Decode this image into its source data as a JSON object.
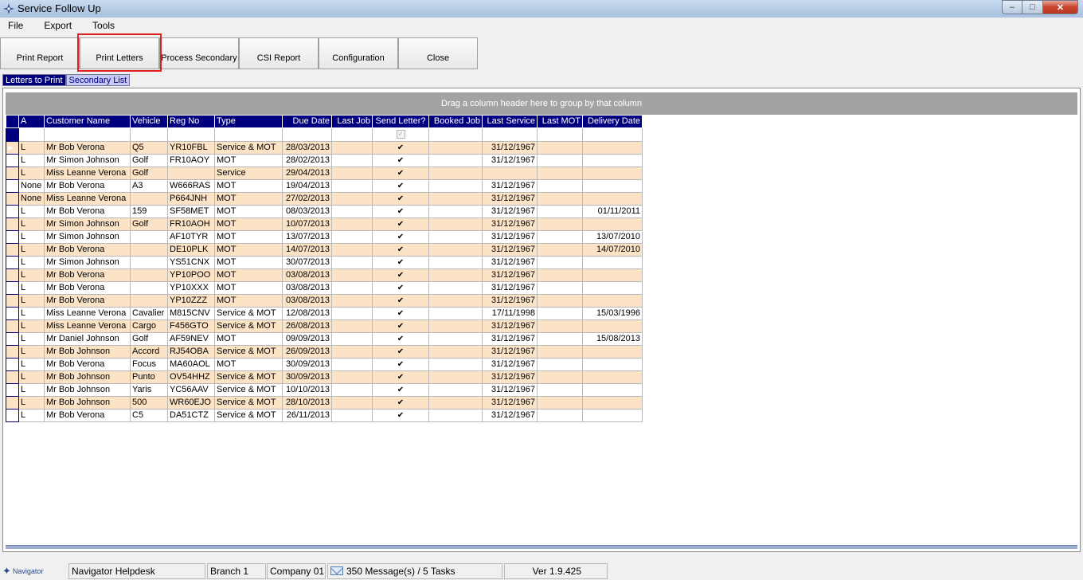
{
  "window": {
    "title": "Service Follow Up",
    "minimize_glyph": "–",
    "maximize_glyph": "□",
    "close_glyph": "✕",
    "icon": "navigator-compass-icon"
  },
  "menu": [
    "File",
    "Export",
    "Tools"
  ],
  "toolbar": {
    "buttons": [
      {
        "label": "Print Report"
      },
      {
        "label": "Print Letters"
      },
      {
        "label": "Process Secondary"
      },
      {
        "label": "CSI Report"
      },
      {
        "label": "Configuration"
      },
      {
        "label": "Close"
      }
    ]
  },
  "tabs": [
    {
      "label": "Letters to Print",
      "active": true
    },
    {
      "label": "Secondary List",
      "active": false
    }
  ],
  "grid": {
    "group_hint": "Drag a column header here to group by that column",
    "columns": [
      "A",
      "Customer Name",
      "Vehicle",
      "Reg No",
      "Type",
      "Due Date",
      "Last Job",
      "Send Letter?",
      "Booked Job",
      "Last Service",
      "Last MOT",
      "Delivery Date"
    ],
    "rows": [
      {
        "a": "L",
        "customer": "Mr Bob Verona",
        "vehicle": "Q5",
        "reg": "YR10FBL",
        "type": "Service  & MOT",
        "due": "28/03/2013",
        "last_job": "",
        "send": true,
        "booked": "",
        "last_service": "31/12/1967",
        "last_mot": "",
        "delivery": ""
      },
      {
        "a": "L",
        "customer": "Mr Simon Johnson",
        "vehicle": "Golf",
        "reg": "FR10AOY",
        "type": "MOT",
        "due": "28/02/2013",
        "last_job": "",
        "send": true,
        "booked": "",
        "last_service": "31/12/1967",
        "last_mot": "",
        "delivery": ""
      },
      {
        "a": "L",
        "customer": "Miss Leanne Verona",
        "vehicle": "Golf",
        "reg": "",
        "type": "Service",
        "due": "29/04/2013",
        "last_job": "",
        "send": true,
        "booked": "",
        "last_service": "",
        "last_mot": "",
        "delivery": ""
      },
      {
        "a": "None",
        "customer": "Mr Bob Verona",
        "vehicle": "A3",
        "reg": "W666RAS",
        "type": "MOT",
        "due": "19/04/2013",
        "last_job": "",
        "send": true,
        "booked": "",
        "last_service": "31/12/1967",
        "last_mot": "",
        "delivery": ""
      },
      {
        "a": "None",
        "customer": "Miss Leanne Verona",
        "vehicle": "",
        "reg": "P664JNH",
        "type": "MOT",
        "due": "27/02/2013",
        "last_job": "",
        "send": true,
        "booked": "",
        "last_service": "31/12/1967",
        "last_mot": "",
        "delivery": ""
      },
      {
        "a": "L",
        "customer": "Mr Bob Verona",
        "vehicle": "159",
        "reg": "SF58MET",
        "type": "MOT",
        "due": "08/03/2013",
        "last_job": "",
        "send": true,
        "booked": "",
        "last_service": "31/12/1967",
        "last_mot": "",
        "delivery": "01/11/2011"
      },
      {
        "a": "L",
        "customer": "Mr Simon Johnson",
        "vehicle": "Golf",
        "reg": "FR10AOH",
        "type": "MOT",
        "due": "10/07/2013",
        "last_job": "",
        "send": true,
        "booked": "",
        "last_service": "31/12/1967",
        "last_mot": "",
        "delivery": ""
      },
      {
        "a": "L",
        "customer": "Mr Simon Johnson",
        "vehicle": "",
        "reg": "AF10TYR",
        "type": "MOT",
        "due": "13/07/2013",
        "last_job": "",
        "send": true,
        "booked": "",
        "last_service": "31/12/1967",
        "last_mot": "",
        "delivery": "13/07/2010"
      },
      {
        "a": "L",
        "customer": "Mr Bob Verona",
        "vehicle": "",
        "reg": "DE10PLK",
        "type": "MOT",
        "due": "14/07/2013",
        "last_job": "",
        "send": true,
        "booked": "",
        "last_service": "31/12/1967",
        "last_mot": "",
        "delivery": "14/07/2010"
      },
      {
        "a": "L",
        "customer": "Mr Simon Johnson",
        "vehicle": "",
        "reg": "YS51CNX",
        "type": "MOT",
        "due": "30/07/2013",
        "last_job": "",
        "send": true,
        "booked": "",
        "last_service": "31/12/1967",
        "last_mot": "",
        "delivery": ""
      },
      {
        "a": "L",
        "customer": "Mr Bob Verona",
        "vehicle": "",
        "reg": "YP10POO",
        "type": "MOT",
        "due": "03/08/2013",
        "last_job": "",
        "send": true,
        "booked": "",
        "last_service": "31/12/1967",
        "last_mot": "",
        "delivery": ""
      },
      {
        "a": "L",
        "customer": "Mr Bob Verona",
        "vehicle": "",
        "reg": "YP10XXX",
        "type": "MOT",
        "due": "03/08/2013",
        "last_job": "",
        "send": true,
        "booked": "",
        "last_service": "31/12/1967",
        "last_mot": "",
        "delivery": ""
      },
      {
        "a": "L",
        "customer": "Mr Bob Verona",
        "vehicle": "",
        "reg": "YP10ZZZ",
        "type": "MOT",
        "due": "03/08/2013",
        "last_job": "",
        "send": true,
        "booked": "",
        "last_service": "31/12/1967",
        "last_mot": "",
        "delivery": ""
      },
      {
        "a": "L",
        "customer": "Miss Leanne Verona",
        "vehicle": "Cavalier",
        "reg": "M815CNV",
        "type": "Service  & MOT",
        "due": "12/08/2013",
        "last_job": "",
        "send": true,
        "booked": "",
        "last_service": "17/11/1998",
        "last_mot": "",
        "delivery": "15/03/1996"
      },
      {
        "a": "L",
        "customer": "Miss Leanne Verona",
        "vehicle": "Cargo",
        "reg": "F456GTO",
        "type": "Service  & MOT",
        "due": "26/08/2013",
        "last_job": "",
        "send": true,
        "booked": "",
        "last_service": "31/12/1967",
        "last_mot": "",
        "delivery": ""
      },
      {
        "a": "L",
        "customer": "Mr Daniel Johnson",
        "vehicle": "Golf",
        "reg": "AF59NEV",
        "type": "MOT",
        "due": "09/09/2013",
        "last_job": "",
        "send": true,
        "booked": "",
        "last_service": "31/12/1967",
        "last_mot": "",
        "delivery": "15/08/2013"
      },
      {
        "a": "L",
        "customer": "Mr Bob Johnson",
        "vehicle": "Accord",
        "reg": "RJ54OBA",
        "type": "Service  & MOT",
        "due": "26/09/2013",
        "last_job": "",
        "send": true,
        "booked": "",
        "last_service": "31/12/1967",
        "last_mot": "",
        "delivery": ""
      },
      {
        "a": "L",
        "customer": "Mr Bob Verona",
        "vehicle": "Focus",
        "reg": "MA60AOL",
        "type": "MOT",
        "due": "30/09/2013",
        "last_job": "",
        "send": true,
        "booked": "",
        "last_service": "31/12/1967",
        "last_mot": "",
        "delivery": ""
      },
      {
        "a": "L",
        "customer": "Mr Bob Johnson",
        "vehicle": "Punto",
        "reg": "OV54HHZ",
        "type": "Service  & MOT",
        "due": "30/09/2013",
        "last_job": "",
        "send": true,
        "booked": "",
        "last_service": "31/12/1967",
        "last_mot": "",
        "delivery": ""
      },
      {
        "a": "L",
        "customer": "Mr Bob Johnson",
        "vehicle": "Yaris",
        "reg": "YC56AAV",
        "type": "Service  & MOT",
        "due": "10/10/2013",
        "last_job": "",
        "send": true,
        "booked": "",
        "last_service": "31/12/1967",
        "last_mot": "",
        "delivery": ""
      },
      {
        "a": "L",
        "customer": "Mr Bob Johnson",
        "vehicle": "500",
        "reg": "WR60EJO",
        "type": "Service  & MOT",
        "due": "28/10/2013",
        "last_job": "",
        "send": true,
        "booked": "",
        "last_service": "31/12/1967",
        "last_mot": "",
        "delivery": ""
      },
      {
        "a": "L",
        "customer": "Mr Bob Verona",
        "vehicle": "C5",
        "reg": "DA51CTZ",
        "type": "Service  & MOT",
        "due": "26/11/2013",
        "last_job": "",
        "send": true,
        "booked": "",
        "last_service": "31/12/1967",
        "last_mot": "",
        "delivery": ""
      }
    ]
  },
  "status": {
    "logo_text": "Navigator",
    "helpdesk": "Navigator Helpdesk",
    "branch": "Branch 1",
    "company": "Company 01",
    "messages": "350 Message(s) / 5 Tasks",
    "version": "Ver 1.9.425"
  },
  "colors": {
    "header_navy": "#00007f",
    "row_alt": "#fde3c6",
    "highlight_red": "#e02020"
  }
}
